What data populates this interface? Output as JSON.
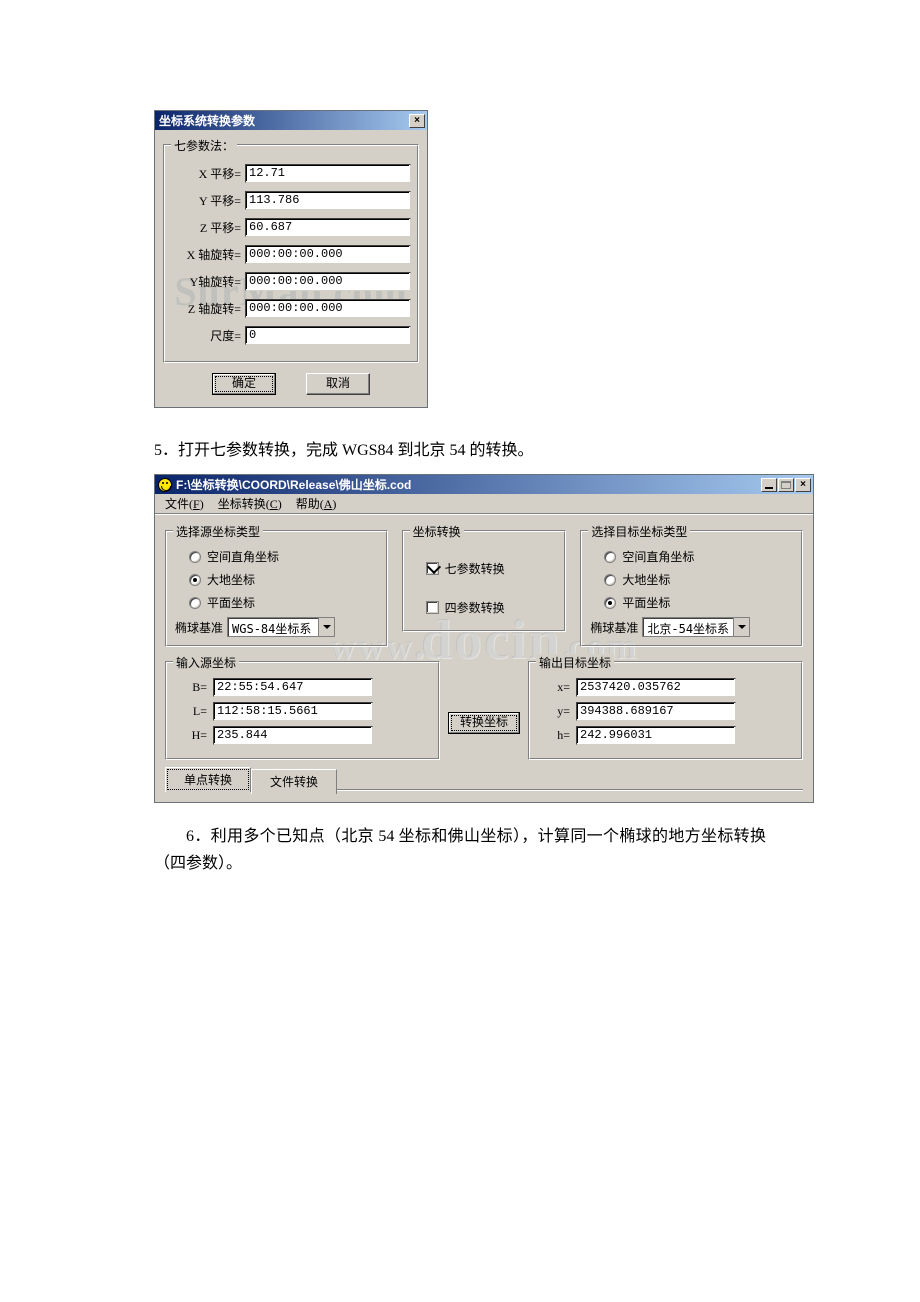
{
  "dlg1": {
    "title": "坐标系统转换参数",
    "group_title": "七参数法：",
    "fields": [
      {
        "label": "X 平移=",
        "value": "12.71"
      },
      {
        "label": "Y 平移=",
        "value": "113.786"
      },
      {
        "label": "Z 平移=",
        "value": "60.687"
      },
      {
        "label": "X 轴旋转=",
        "value": "000:00:00.000"
      },
      {
        "label": "Y轴旋转=",
        "value": "000:00:00.000"
      },
      {
        "label": "Z 轴旋转=",
        "value": "000:00:00.000"
      },
      {
        "label": "尺度=",
        "value": "0"
      }
    ],
    "ok": "确定",
    "cancel": "取消",
    "watermark": "SurMap.com"
  },
  "caption5": "5．打开七参数转换，完成 WGS84 到北京 54 的转换。",
  "win2": {
    "title": "F:\\坐标转换\\COORD\\Release\\佛山坐标.cod",
    "menus": [
      {
        "text": "文件(",
        "u": "F",
        "after": ")"
      },
      {
        "text": "坐标转换(",
        "u": "C",
        "after": ")"
      },
      {
        "text": "帮助(",
        "u": "A",
        "after": ")"
      }
    ],
    "src_type": {
      "title": "选择源坐标类型",
      "opts": [
        "空间直角坐标",
        "大地坐标",
        "平面坐标"
      ],
      "checked": 1,
      "ell_label": "椭球基准",
      "ell_value": "WGS-84坐标系"
    },
    "conv": {
      "title": "坐标转换",
      "seven": "七参数转换",
      "four": "四参数转换",
      "seven_checked": true,
      "four_checked": false
    },
    "dst_type": {
      "title": "选择目标坐标类型",
      "opts": [
        "空间直角坐标",
        "大地坐标",
        "平面坐标"
      ],
      "checked": 2,
      "ell_label": "椭球基准",
      "ell_value": "北京-54坐标系"
    },
    "src_coord": {
      "title": "输入源坐标",
      "rows": [
        {
          "l": "B=",
          "v": "22:55:54.647"
        },
        {
          "l": "L=",
          "v": "112:58:15.5661"
        },
        {
          "l": "H=",
          "v": "235.844"
        }
      ]
    },
    "convert_btn": "转换坐标",
    "dst_coord": {
      "title": "输出目标坐标",
      "rows": [
        {
          "l": "x=",
          "v": "2537420.035762"
        },
        {
          "l": "y=",
          "v": "394388.689167"
        },
        {
          "l": "h=",
          "v": "242.996031"
        }
      ]
    },
    "tabs": [
      "单点转换",
      "文件转换"
    ],
    "active_tab": 0,
    "watermark": "www.docin.com"
  },
  "caption6": "6．利用多个已知点（北京 54 坐标和佛山坐标），计算同一个椭球的地方坐标转换（四参数）。"
}
